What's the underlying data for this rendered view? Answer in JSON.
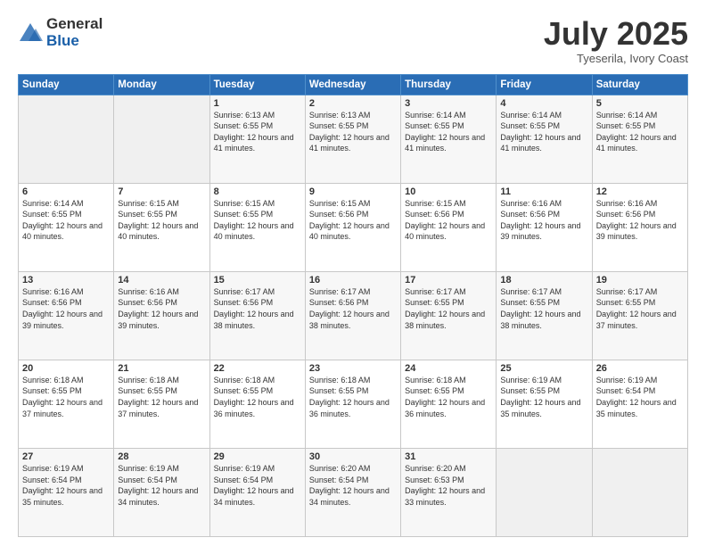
{
  "logo": {
    "general": "General",
    "blue": "Blue"
  },
  "title": "July 2025",
  "subtitle": "Tyeserila, Ivory Coast",
  "days_of_week": [
    "Sunday",
    "Monday",
    "Tuesday",
    "Wednesday",
    "Thursday",
    "Friday",
    "Saturday"
  ],
  "weeks": [
    [
      {
        "day": "",
        "info": ""
      },
      {
        "day": "",
        "info": ""
      },
      {
        "day": "1",
        "info": "Sunrise: 6:13 AM\nSunset: 6:55 PM\nDaylight: 12 hours and 41 minutes."
      },
      {
        "day": "2",
        "info": "Sunrise: 6:13 AM\nSunset: 6:55 PM\nDaylight: 12 hours and 41 minutes."
      },
      {
        "day": "3",
        "info": "Sunrise: 6:14 AM\nSunset: 6:55 PM\nDaylight: 12 hours and 41 minutes."
      },
      {
        "day": "4",
        "info": "Sunrise: 6:14 AM\nSunset: 6:55 PM\nDaylight: 12 hours and 41 minutes."
      },
      {
        "day": "5",
        "info": "Sunrise: 6:14 AM\nSunset: 6:55 PM\nDaylight: 12 hours and 41 minutes."
      }
    ],
    [
      {
        "day": "6",
        "info": "Sunrise: 6:14 AM\nSunset: 6:55 PM\nDaylight: 12 hours and 40 minutes."
      },
      {
        "day": "7",
        "info": "Sunrise: 6:15 AM\nSunset: 6:55 PM\nDaylight: 12 hours and 40 minutes."
      },
      {
        "day": "8",
        "info": "Sunrise: 6:15 AM\nSunset: 6:55 PM\nDaylight: 12 hours and 40 minutes."
      },
      {
        "day": "9",
        "info": "Sunrise: 6:15 AM\nSunset: 6:56 PM\nDaylight: 12 hours and 40 minutes."
      },
      {
        "day": "10",
        "info": "Sunrise: 6:15 AM\nSunset: 6:56 PM\nDaylight: 12 hours and 40 minutes."
      },
      {
        "day": "11",
        "info": "Sunrise: 6:16 AM\nSunset: 6:56 PM\nDaylight: 12 hours and 39 minutes."
      },
      {
        "day": "12",
        "info": "Sunrise: 6:16 AM\nSunset: 6:56 PM\nDaylight: 12 hours and 39 minutes."
      }
    ],
    [
      {
        "day": "13",
        "info": "Sunrise: 6:16 AM\nSunset: 6:56 PM\nDaylight: 12 hours and 39 minutes."
      },
      {
        "day": "14",
        "info": "Sunrise: 6:16 AM\nSunset: 6:56 PM\nDaylight: 12 hours and 39 minutes."
      },
      {
        "day": "15",
        "info": "Sunrise: 6:17 AM\nSunset: 6:56 PM\nDaylight: 12 hours and 38 minutes."
      },
      {
        "day": "16",
        "info": "Sunrise: 6:17 AM\nSunset: 6:56 PM\nDaylight: 12 hours and 38 minutes."
      },
      {
        "day": "17",
        "info": "Sunrise: 6:17 AM\nSunset: 6:55 PM\nDaylight: 12 hours and 38 minutes."
      },
      {
        "day": "18",
        "info": "Sunrise: 6:17 AM\nSunset: 6:55 PM\nDaylight: 12 hours and 38 minutes."
      },
      {
        "day": "19",
        "info": "Sunrise: 6:17 AM\nSunset: 6:55 PM\nDaylight: 12 hours and 37 minutes."
      }
    ],
    [
      {
        "day": "20",
        "info": "Sunrise: 6:18 AM\nSunset: 6:55 PM\nDaylight: 12 hours and 37 minutes."
      },
      {
        "day": "21",
        "info": "Sunrise: 6:18 AM\nSunset: 6:55 PM\nDaylight: 12 hours and 37 minutes."
      },
      {
        "day": "22",
        "info": "Sunrise: 6:18 AM\nSunset: 6:55 PM\nDaylight: 12 hours and 36 minutes."
      },
      {
        "day": "23",
        "info": "Sunrise: 6:18 AM\nSunset: 6:55 PM\nDaylight: 12 hours and 36 minutes."
      },
      {
        "day": "24",
        "info": "Sunrise: 6:18 AM\nSunset: 6:55 PM\nDaylight: 12 hours and 36 minutes."
      },
      {
        "day": "25",
        "info": "Sunrise: 6:19 AM\nSunset: 6:55 PM\nDaylight: 12 hours and 35 minutes."
      },
      {
        "day": "26",
        "info": "Sunrise: 6:19 AM\nSunset: 6:54 PM\nDaylight: 12 hours and 35 minutes."
      }
    ],
    [
      {
        "day": "27",
        "info": "Sunrise: 6:19 AM\nSunset: 6:54 PM\nDaylight: 12 hours and 35 minutes."
      },
      {
        "day": "28",
        "info": "Sunrise: 6:19 AM\nSunset: 6:54 PM\nDaylight: 12 hours and 34 minutes."
      },
      {
        "day": "29",
        "info": "Sunrise: 6:19 AM\nSunset: 6:54 PM\nDaylight: 12 hours and 34 minutes."
      },
      {
        "day": "30",
        "info": "Sunrise: 6:20 AM\nSunset: 6:54 PM\nDaylight: 12 hours and 34 minutes."
      },
      {
        "day": "31",
        "info": "Sunrise: 6:20 AM\nSunset: 6:53 PM\nDaylight: 12 hours and 33 minutes."
      },
      {
        "day": "",
        "info": ""
      },
      {
        "day": "",
        "info": ""
      }
    ]
  ]
}
